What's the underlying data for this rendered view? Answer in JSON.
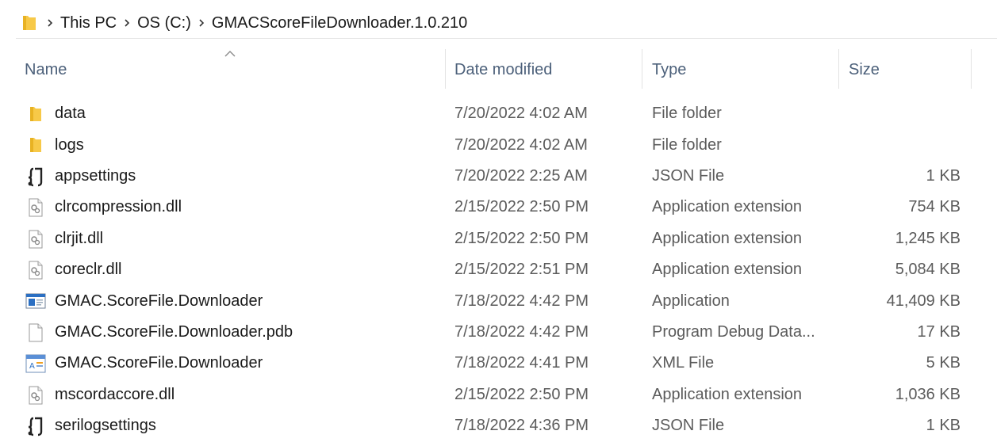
{
  "breadcrumb": {
    "items": [
      "This PC",
      "OS (C:)",
      "GMACScoreFileDownloader.1.0.210"
    ]
  },
  "columns": {
    "name": "Name",
    "date": "Date modified",
    "type": "Type",
    "size": "Size"
  },
  "files": [
    {
      "name": "data",
      "date": "7/20/2022 4:02 AM",
      "type": "File folder",
      "size": "",
      "icon": "folder-icon"
    },
    {
      "name": "logs",
      "date": "7/20/2022 4:02 AM",
      "type": "File folder",
      "size": "",
      "icon": "folder-icon"
    },
    {
      "name": "appsettings",
      "date": "7/20/2022 2:25 AM",
      "type": "JSON File",
      "size": "1 KB",
      "icon": "json-file-icon"
    },
    {
      "name": "clrcompression.dll",
      "date": "2/15/2022 2:50 PM",
      "type": "Application extension",
      "size": "754 KB",
      "icon": "dll-file-icon"
    },
    {
      "name": "clrjit.dll",
      "date": "2/15/2022 2:50 PM",
      "type": "Application extension",
      "size": "1,245 KB",
      "icon": "dll-file-icon"
    },
    {
      "name": "coreclr.dll",
      "date": "2/15/2022 2:51 PM",
      "type": "Application extension",
      "size": "5,084 KB",
      "icon": "dll-file-icon"
    },
    {
      "name": "GMAC.ScoreFile.Downloader",
      "date": "7/18/2022 4:42 PM",
      "type": "Application",
      "size": "41,409 KB",
      "icon": "application-icon"
    },
    {
      "name": "GMAC.ScoreFile.Downloader.pdb",
      "date": "7/18/2022 4:42 PM",
      "type": "Program Debug Data...",
      "size": "17 KB",
      "icon": "blank-file-icon"
    },
    {
      "name": "GMAC.ScoreFile.Downloader",
      "date": "7/18/2022 4:41 PM",
      "type": "XML File",
      "size": "5 KB",
      "icon": "xml-file-icon"
    },
    {
      "name": "mscordaccore.dll",
      "date": "2/15/2022 2:50 PM",
      "type": "Application extension",
      "size": "1,036 KB",
      "icon": "dll-file-icon"
    },
    {
      "name": "serilogsettings",
      "date": "7/18/2022 4:36 PM",
      "type": "JSON File",
      "size": "1 KB",
      "icon": "json-file-icon"
    }
  ],
  "colors": {
    "folder": "#f7c948",
    "header_text": "#4c607a",
    "secondary_text": "#5b5b5b"
  }
}
